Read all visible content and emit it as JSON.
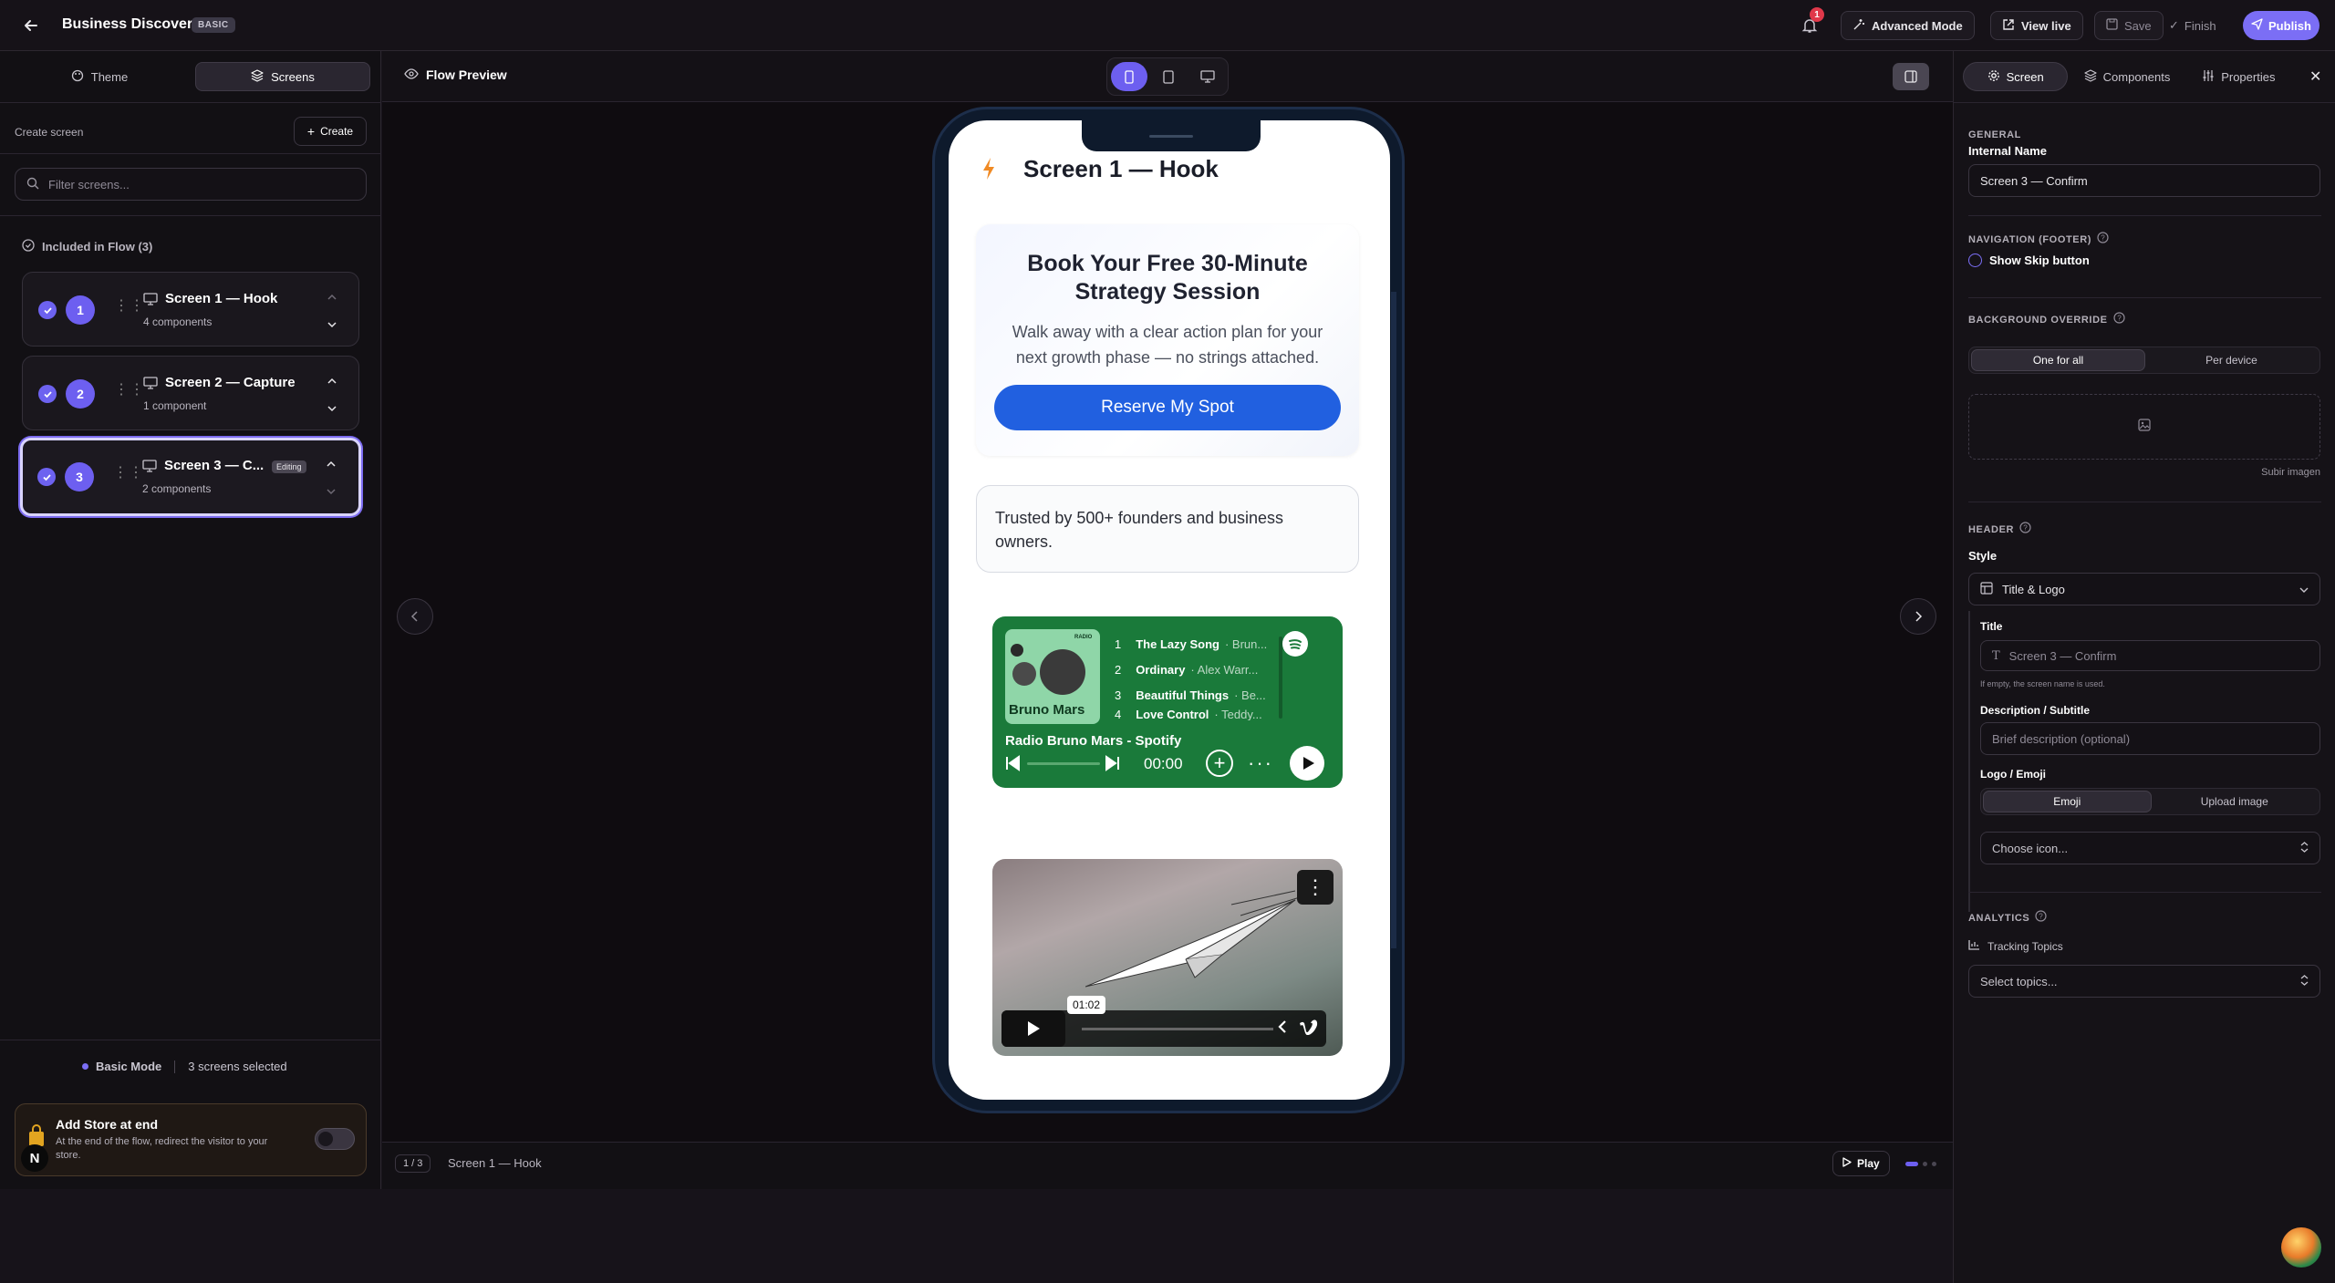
{
  "header": {
    "title": "Business Discovery",
    "plan_badge": "BASIC",
    "notification_count": "1",
    "advanced_mode": "Advanced Mode",
    "view_live": "View live",
    "save": "Save",
    "finish": "Finish",
    "publish": "Publish"
  },
  "sidebar": {
    "tabs": [
      "Theme",
      "Screens"
    ],
    "create_label": "Create screen",
    "create_button": "Create",
    "filter_placeholder": "Filter screens...",
    "section_title": "Included in Flow (3)",
    "screens": [
      {
        "number": "1",
        "title": "Screen 1 — Hook",
        "subtitle": "4 components"
      },
      {
        "number": "2",
        "title": "Screen 2 — Capture",
        "subtitle": "1 component"
      },
      {
        "number": "3",
        "title": "Screen 3 — C...",
        "subtitle": "2 components",
        "badge": "Editing"
      }
    ],
    "mode_label": "Basic Mode",
    "selected_count": "3 screens selected",
    "store": {
      "title": "Add Store at end",
      "description": "At the end of the flow, redirect the visitor to your store.",
      "toggle": "off"
    }
  },
  "preview": {
    "title": "Flow Preview",
    "pagination": "1 / 3",
    "current_screen": "Screen 1 — Hook",
    "play": "Play"
  },
  "phone": {
    "screen_title": "Screen 1 — Hook",
    "hero_title": "Book Your Free 30-Minute Strategy Session",
    "hero_text": "Walk away with a clear action plan for your next growth phase — no strings attached.",
    "cta": "Reserve My Spot",
    "trust_text": "Trusted by 500+ founders and business owners.",
    "spotify": {
      "badge": "RADIO",
      "artist": "Bruno Mars",
      "tracks": [
        {
          "n": "1",
          "title": "The Lazy Song",
          "artist": "Brun..."
        },
        {
          "n": "2",
          "title": "Ordinary",
          "artist": "Alex Warr..."
        },
        {
          "n": "3",
          "title": "Beautiful Things",
          "artist": "Be..."
        },
        {
          "n": "4",
          "title": "Love Control",
          "artist": "Teddy..."
        }
      ],
      "playlist": "Radio Bruno Mars - Spotify",
      "time": "00:00"
    },
    "video": {
      "timestamp": "01:02"
    }
  },
  "panel": {
    "tabs": [
      "Screen",
      "Components",
      "Properties"
    ],
    "general_cap": "GENERAL",
    "internal_name_label": "Internal Name",
    "internal_name": "Screen 3 — Confirm",
    "nav_cap": "NAVIGATION (FOOTER)",
    "show_skip": "Show Skip button",
    "bg_cap": "BACKGROUND OVERRIDE",
    "bg_options": [
      "One for all",
      "Per device"
    ],
    "upload_image_link": "Subir imagen",
    "header_cap": "HEADER",
    "style_label": "Style",
    "style_value": "Title & Logo",
    "title_label": "Title",
    "title_placeholder": "Screen 3 — Confirm",
    "title_hint": "If empty, the screen name is used.",
    "desc_label": "Description / Subtitle",
    "desc_placeholder": "Brief description (optional)",
    "logo_label": "Logo / Emoji",
    "logo_options": [
      "Emoji",
      "Upload image"
    ],
    "icon_placeholder": "Choose icon...",
    "analytics_cap": "ANALYTICS",
    "tracking_label": "Tracking Topics",
    "topics_placeholder": "Select topics..."
  },
  "colors": {
    "accent": "#6d5ff0",
    "cta": "#2160e0",
    "spotify": "#1a7a3a",
    "background": "#17131a"
  }
}
